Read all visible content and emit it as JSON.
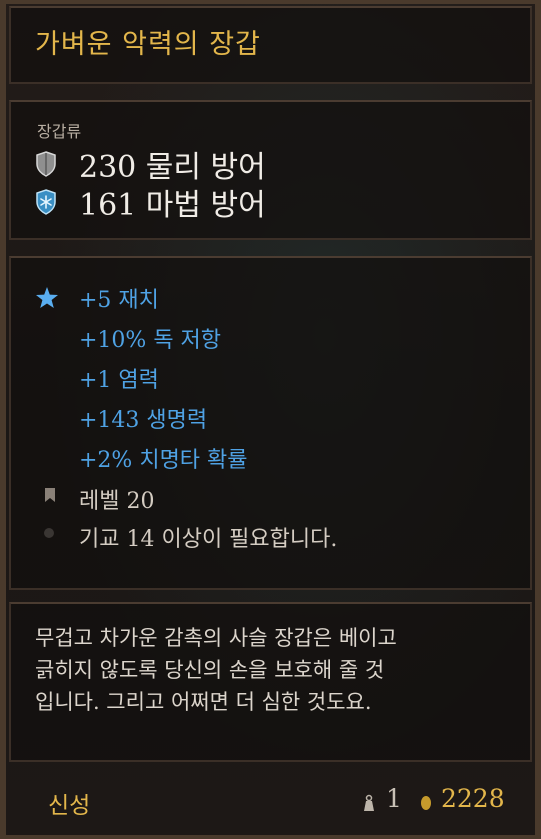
{
  "item": {
    "name": "가벼운 악력의 장갑",
    "category": "장갑류",
    "physical_armor": "230 물리 방어",
    "magic_armor": "161 마법 방어"
  },
  "modifiers": [
    "+5 재치",
    "+10% 독 저항",
    "+1 염력",
    "+143 생명력",
    "+2% 치명타 확률"
  ],
  "level": "레벨 20",
  "requirement": "기교 14 이상이 필요합니다.",
  "description": [
    "무겁고 차가운 감촉의 사슬 장갑은 베이고",
    "긁히지 않도록 당신의 손을 보호해 줄 것",
    "입니다. 그리고 어쩌면 더 심한 것도요."
  ],
  "footer": {
    "rarity": "신성",
    "weight": "1",
    "value": "2228"
  },
  "colors": {
    "gold_text": "#e3b64b",
    "modifier_blue": "#4fa2e4",
    "body_text": "#dcd5cc",
    "panel_border": "#3b2f27"
  },
  "icons": {
    "physical_armor": "shield-icon",
    "magic_armor": "snowflake-shield-icon",
    "modifier": "star-icon",
    "level": "bookmark-icon",
    "weight": "weight-icon",
    "gold": "coin-icon"
  }
}
